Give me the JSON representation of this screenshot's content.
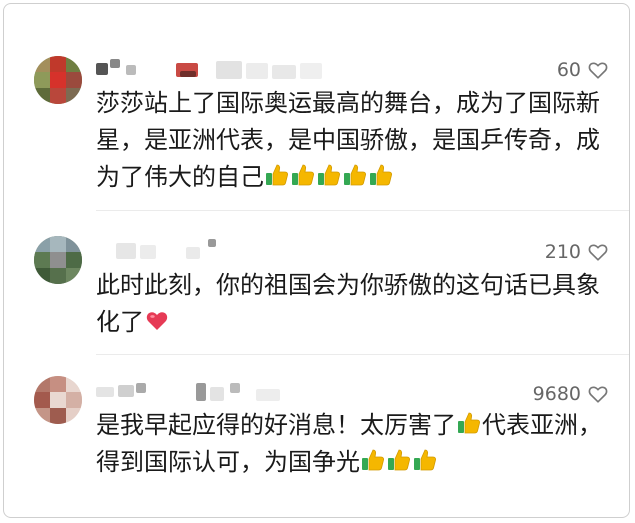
{
  "comments": [
    {
      "likes": "60",
      "text_parts": [
        "莎莎站上了国际奥运最高的舞台，成为了国际新星，是亚洲代表，是中国骄傲，是国乒传奇，成为了伟大的自己"
      ],
      "emojis": [
        "thumbs-up-icon",
        "thumbs-up-icon",
        "thumbs-up-icon",
        "thumbs-up-icon",
        "thumbs-up-icon"
      ]
    },
    {
      "likes": "210",
      "text_parts": [
        "此时此刻，你的祖国会为你骄傲的这句话已具象化了"
      ],
      "emojis": [
        "heart-emoji-icon"
      ]
    },
    {
      "likes": "9680",
      "text_parts": [
        "是我早起应得的好消息！太厉害了",
        "代表亚洲，得到国际认可，为国争光"
      ],
      "emojis": [
        "thumbs-up-icon",
        "thumbs-up-icon",
        "thumbs-up-icon",
        "thumbs-up-icon"
      ]
    }
  ],
  "icons": {
    "like": "heart-outline-icon"
  },
  "colors": {
    "text": "#1a1a1a",
    "like_count": "#666666",
    "thumb": "#f5b700",
    "cuff": "#34a853",
    "heart": "#e63a55"
  }
}
